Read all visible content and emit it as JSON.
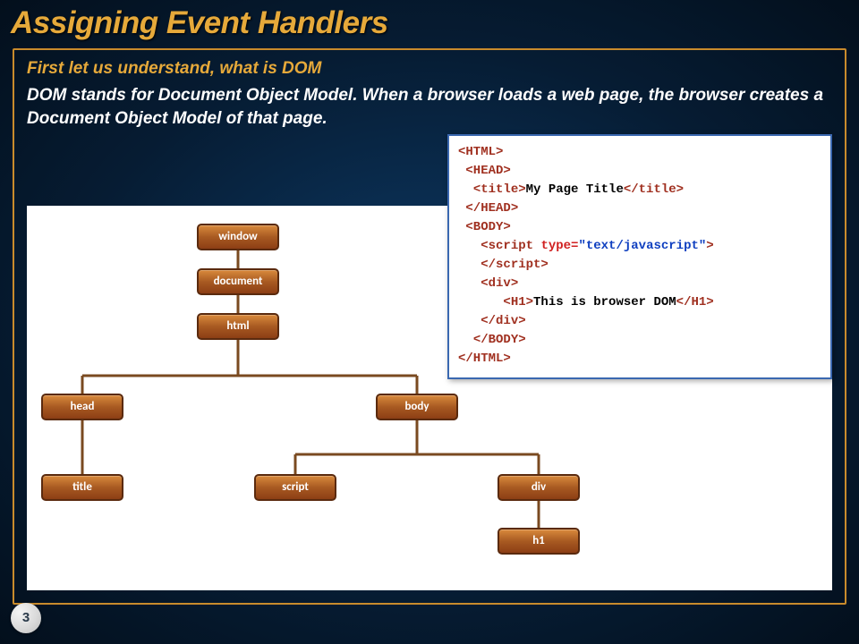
{
  "title": "Assigning Event Handlers",
  "heading": "First let us understand, what is DOM",
  "body": "DOM stands for Document Object Model. When a browser loads a web page, the browser creates a Document Object Model of that page.",
  "page_number": "3",
  "tree": {
    "window": "window",
    "document": "document",
    "html": "html",
    "head": "head",
    "body": "body",
    "title": "title",
    "script": "script",
    "div": "div",
    "h1": "h1"
  },
  "code": {
    "html_open": "<HTML>",
    "head_open": "<HEAD>",
    "title_open": "<title>",
    "title_text": "My Page Title",
    "title_close": "</title>",
    "head_close": "</HEAD>",
    "body_open": "<BODY>",
    "script_open_a": "<script ",
    "script_attr": "type=",
    "script_val": "\"text/javascript\"",
    "script_open_b": ">",
    "script_close": "</script>",
    "div_open": "<div>",
    "h1_open": "<H1>",
    "h1_text": "This is browser DOM",
    "h1_close": "</H1>",
    "div_close": "</div>",
    "body_close": "</BODY>",
    "html_close": "</HTML>"
  }
}
